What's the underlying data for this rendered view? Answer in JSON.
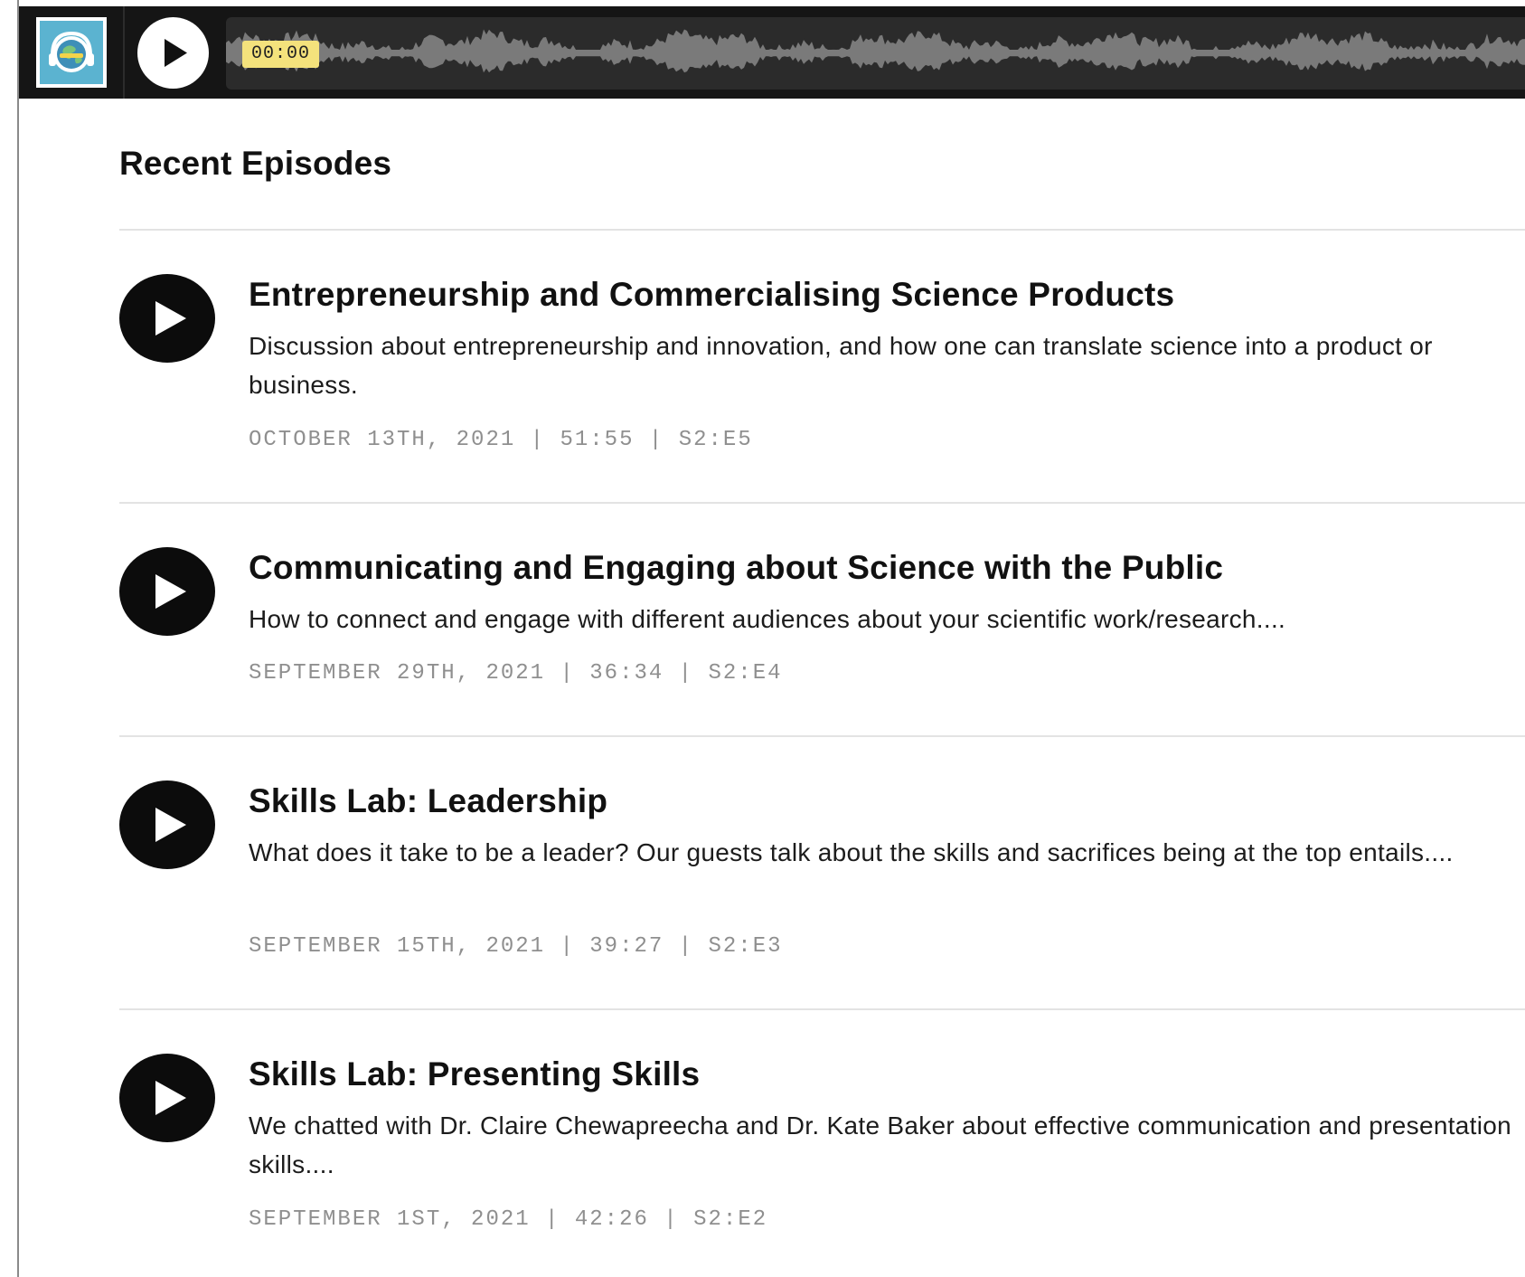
{
  "player": {
    "current_time": "00:00",
    "cover_icon": "globe-headphones-logo",
    "play_icon": "play-icon"
  },
  "colors": {
    "player_bg": "#151515",
    "time_badge": "#f4e27c",
    "cover_bg": "#5bb3d0",
    "waveform": "#7a7a7a",
    "meta_text": "#8f8f8f"
  },
  "section_title": "Recent Episodes",
  "episodes": [
    {
      "title": "Entrepreneurship and Commercialising Science Products",
      "description": "Discussion about entrepreneurship and innovation, and how one can translate science into a product or business.",
      "date": "OCTOBER 13TH, 2021",
      "duration": "51:55",
      "episode": "S2:E5"
    },
    {
      "title": "Communicating and Engaging about Science with the Public",
      "description": "How to connect and engage with different audiences about your scientific work/research....",
      "date": "SEPTEMBER 29TH, 2021",
      "duration": "36:34",
      "episode": "S2:E4"
    },
    {
      "title": "Skills Lab: Leadership",
      "description": "What does it take to be a leader? Our guests talk about the skills and sacrifices being at the top entails....",
      "date": "SEPTEMBER 15TH, 2021",
      "duration": "39:27",
      "episode": "S2:E3"
    },
    {
      "title": "Skills Lab: Presenting Skills",
      "description": "We chatted with Dr. Claire Chewapreecha and Dr. Kate Baker about effective communication and presentation skills....",
      "date": "SEPTEMBER 1ST, 2021",
      "duration": "42:26",
      "episode": "S2:E2"
    }
  ]
}
